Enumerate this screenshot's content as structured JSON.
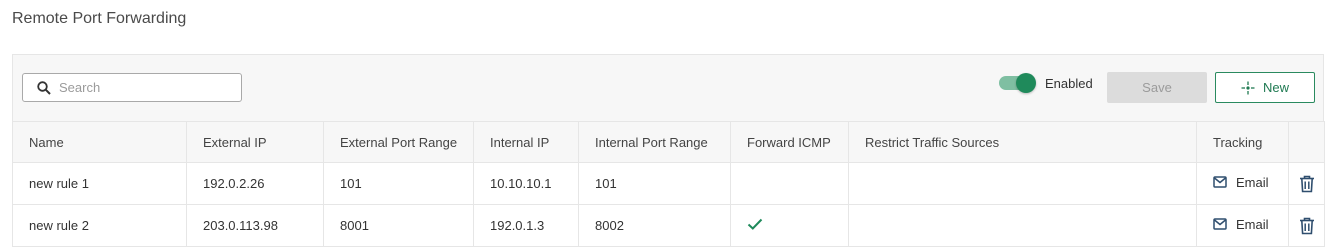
{
  "page": {
    "title": "Remote Port Forwarding"
  },
  "toolbar": {
    "search_placeholder": "Search",
    "search_value": "",
    "toggle_label": "Enabled",
    "toggle_on": true,
    "save_label": "Save",
    "new_label": "New"
  },
  "colors": {
    "accent": "#1f8a5b",
    "toggle_track": "#7fbfa2",
    "icon_blue": "#2f4e6e"
  },
  "table": {
    "columns": [
      "Name",
      "External IP",
      "External Port Range",
      "Internal IP",
      "Internal Port Range",
      "Forward ICMP",
      "Restrict Traffic Sources",
      "Tracking"
    ],
    "rows": [
      {
        "name": "new rule 1",
        "external_ip": "192.0.2.26",
        "external_port_range": "101",
        "internal_ip": "10.10.10.1",
        "internal_port_range": "101",
        "forward_icmp": false,
        "restrict_traffic_sources": "",
        "tracking": "Email"
      },
      {
        "name": "new rule 2",
        "external_ip": "203.0.113.98",
        "external_port_range": "8001",
        "internal_ip": "192.0.1.3",
        "internal_port_range": "8002",
        "forward_icmp": true,
        "restrict_traffic_sources": "",
        "tracking": "Email"
      }
    ]
  }
}
